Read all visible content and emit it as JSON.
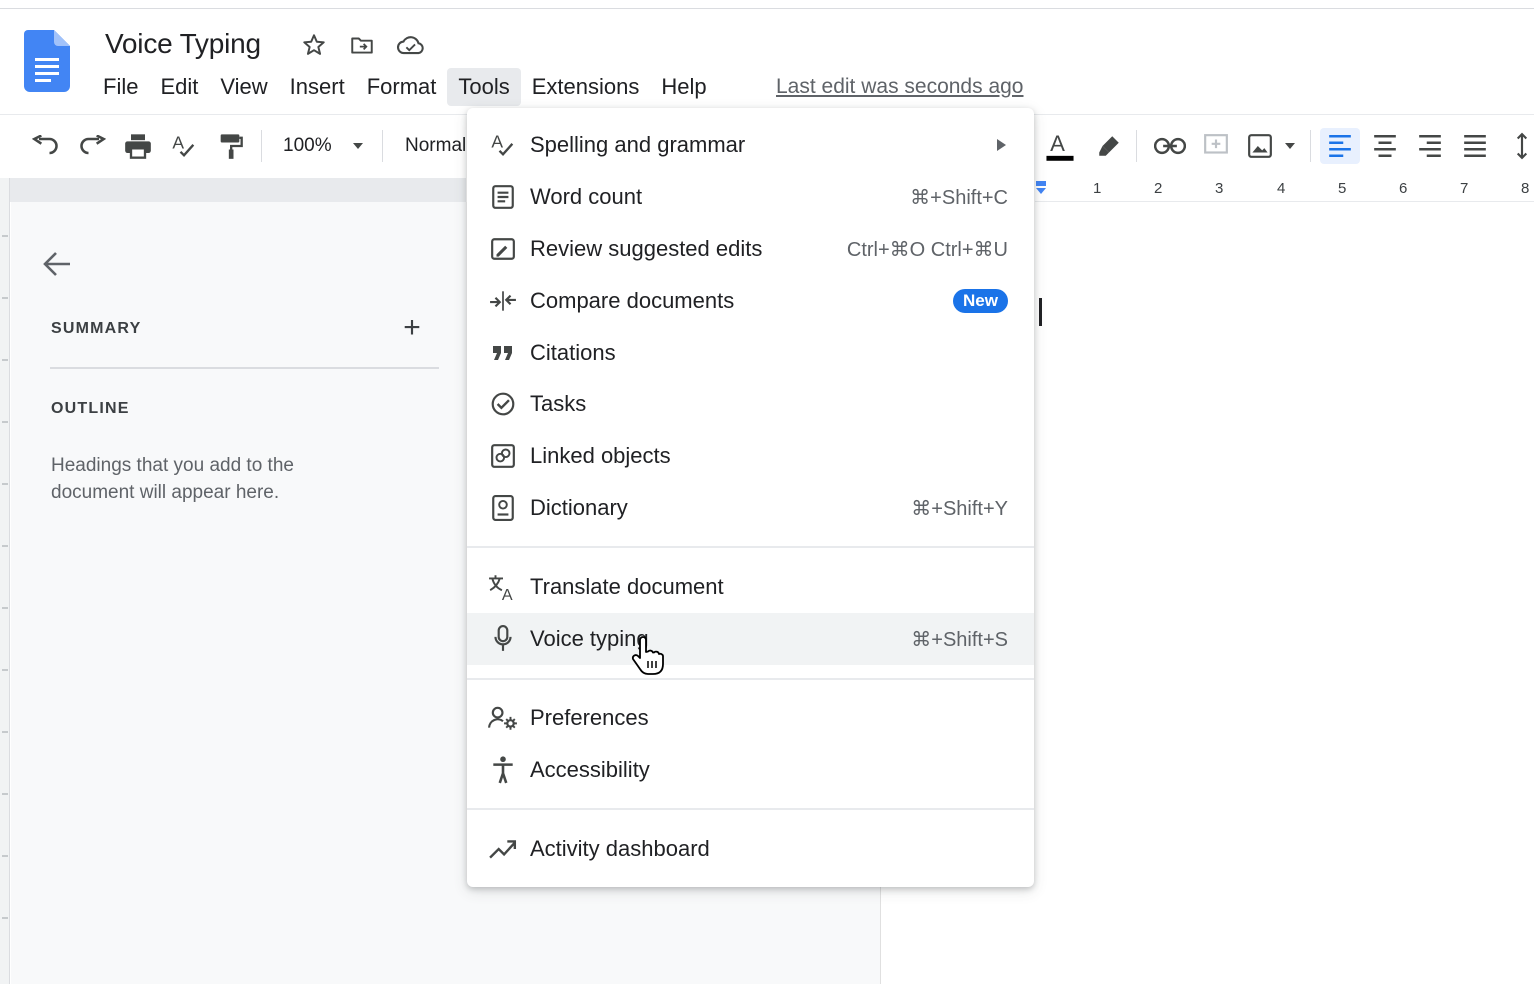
{
  "header": {
    "title": "Voice Typing",
    "last_edit": "Last edit was seconds ago",
    "menu": [
      "File",
      "Edit",
      "View",
      "Insert",
      "Format",
      "Tools",
      "Extensions",
      "Help"
    ],
    "active_menu": "Tools"
  },
  "toolbar": {
    "zoom": "100%",
    "style": "Normal"
  },
  "ruler": {
    "numbers": [
      "1",
      "2",
      "3",
      "4",
      "5",
      "6",
      "7",
      "8"
    ]
  },
  "outline_panel": {
    "summary_label": "SUMMARY",
    "outline_label": "OUTLINE",
    "hint": "Headings that you add to the document will appear here."
  },
  "tools_menu": {
    "items": [
      {
        "label": "Spelling and grammar",
        "shortcut": "",
        "icon": "spellcheck-icon",
        "submenu": true
      },
      {
        "label": "Word count",
        "shortcut": "⌘+Shift+C",
        "icon": "word-count-icon"
      },
      {
        "label": "Review suggested edits",
        "shortcut": "Ctrl+⌘O Ctrl+⌘U",
        "icon": "review-edits-icon"
      },
      {
        "label": "Compare documents",
        "badge": "New",
        "icon": "compare-icon"
      },
      {
        "label": "Citations",
        "shortcut": "",
        "icon": "quote-icon"
      },
      {
        "label": "Tasks",
        "shortcut": "",
        "icon": "tasks-icon"
      },
      {
        "label": "Linked objects",
        "shortcut": "",
        "icon": "linked-objects-icon"
      },
      {
        "label": "Dictionary",
        "shortcut": "⌘+Shift+Y",
        "icon": "dictionary-icon"
      },
      {
        "label": "Translate document",
        "shortcut": "",
        "icon": "translate-icon"
      },
      {
        "label": "Voice typing",
        "shortcut": "⌘+Shift+S",
        "icon": "microphone-icon",
        "hovered": true
      },
      {
        "label": "Preferences",
        "shortcut": "",
        "icon": "preferences-icon"
      },
      {
        "label": "Accessibility",
        "shortcut": "",
        "icon": "accessibility-icon"
      },
      {
        "label": "Activity dashboard",
        "shortcut": "",
        "icon": "activity-icon"
      }
    ]
  },
  "colors": {
    "docs_blue": "#4285f4",
    "badge_blue": "#1a73e8",
    "hover_gray": "#f1f3f4",
    "active_menu_bg": "#e8eaed"
  }
}
